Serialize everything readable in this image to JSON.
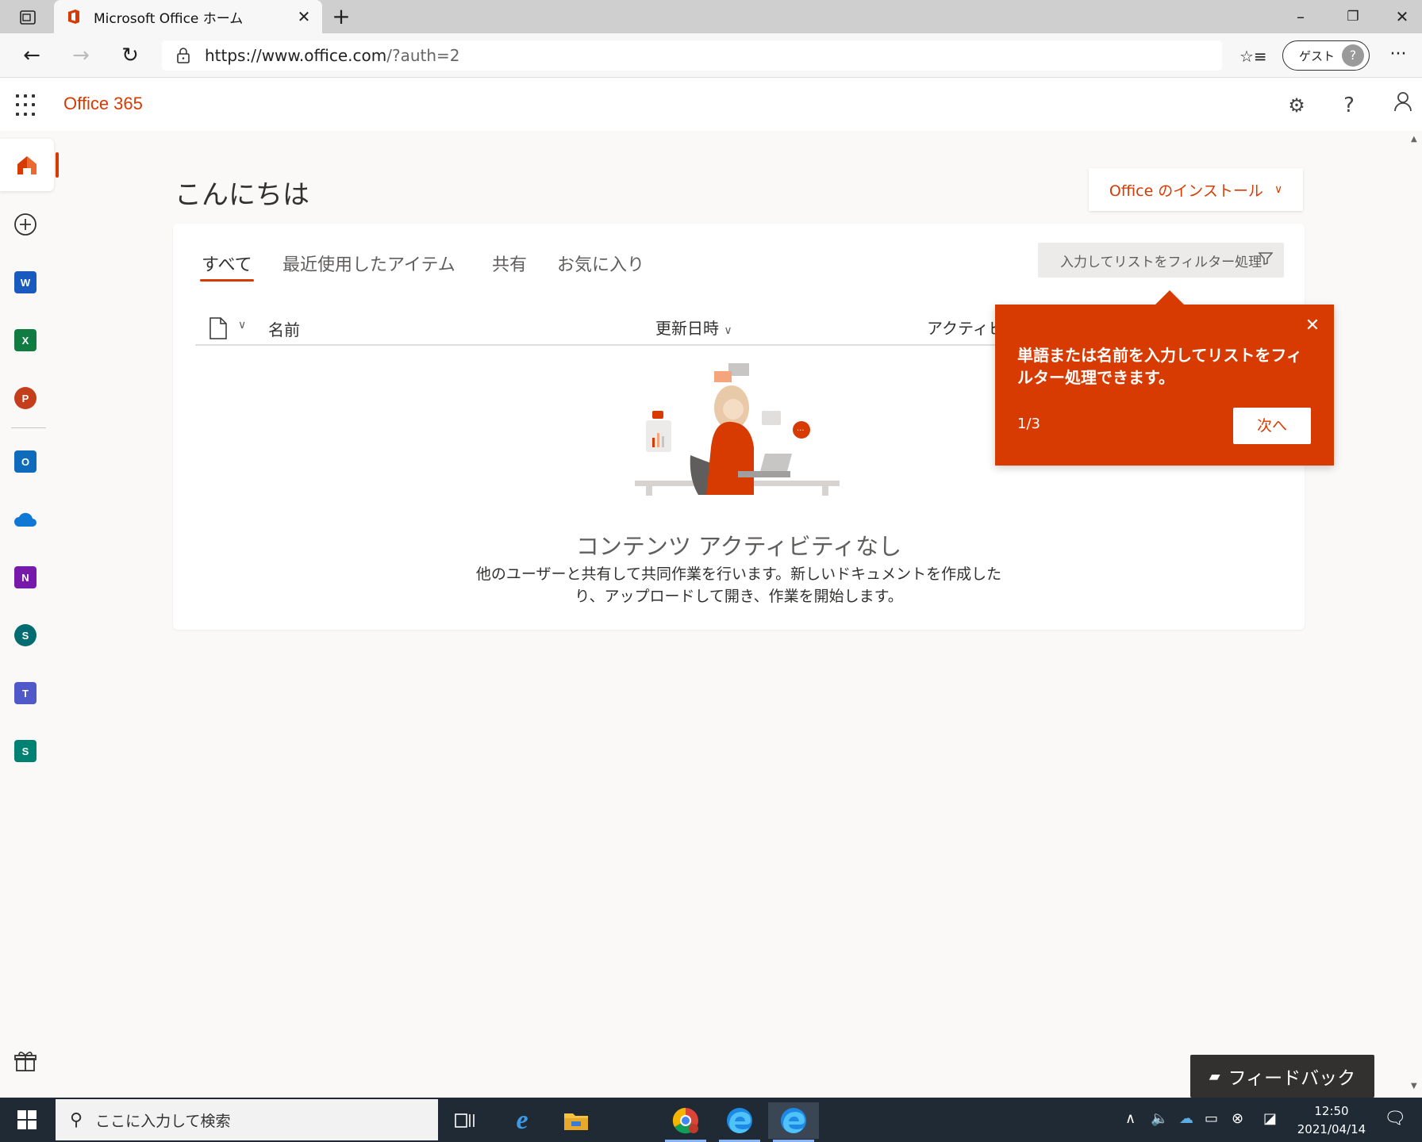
{
  "browser": {
    "tab_title": "Microsoft Office ホーム",
    "tab_close": "✕",
    "new_tab": "+",
    "url": {
      "host": "https://www.office.com",
      "path": "/?auth=2"
    },
    "guest_label": "ゲスト",
    "more": "···",
    "window_controls": {
      "minimize": "–",
      "restore": "❐",
      "close": "✕"
    }
  },
  "header": {
    "brand": "Office 365",
    "settings_icon": "⚙",
    "help_icon": "?",
    "account_icon": "person"
  },
  "rail": {
    "items": [
      {
        "name": "home",
        "letter": "",
        "color": "#d83b01"
      },
      {
        "name": "create",
        "letter": "+",
        "color": "#323130"
      },
      {
        "name": "word",
        "letter": "W",
        "color": "#185abd"
      },
      {
        "name": "excel",
        "letter": "X",
        "color": "#107c41"
      },
      {
        "name": "powerpoint",
        "letter": "P",
        "color": "#c43e1c"
      },
      {
        "name": "outlook",
        "letter": "O",
        "color": "#0f6cbd"
      },
      {
        "name": "onedrive",
        "letter": "",
        "color": "#0f78d4"
      },
      {
        "name": "onenote",
        "letter": "N",
        "color": "#7719aa"
      },
      {
        "name": "sharepoint",
        "letter": "S",
        "color": "#036c70"
      },
      {
        "name": "teams",
        "letter": "T",
        "color": "#5059c9"
      },
      {
        "name": "sway",
        "letter": "S",
        "color": "#008272"
      }
    ]
  },
  "main": {
    "greeting": "こんにちは",
    "install_button": "Office のインストール",
    "tabs": [
      "すべて",
      "最近使用したアイテム",
      "共有",
      "お気に入り"
    ],
    "filter_placeholder": "入力してリストをフィルター処理",
    "columns": {
      "name": "名前",
      "modified": "更新日時",
      "activity": "アクティビ"
    },
    "empty_title": "コンテンツ アクティビティなし",
    "empty_desc_line1": "他のユーザーと共有して共同作業を行います。新しいドキュメントを作成した",
    "empty_desc_line2": "り、アップロードして開き、作業を開始します。"
  },
  "callout": {
    "text": "単語または名前を入力してリストをフィルター処理できます。",
    "step": "1/3",
    "next_button": "次へ",
    "close": "✕"
  },
  "feedback": {
    "label": "フィードバック"
  },
  "taskbar": {
    "search_placeholder": "ここに入力して検索",
    "time": "12:50",
    "date": "2021/04/14"
  }
}
